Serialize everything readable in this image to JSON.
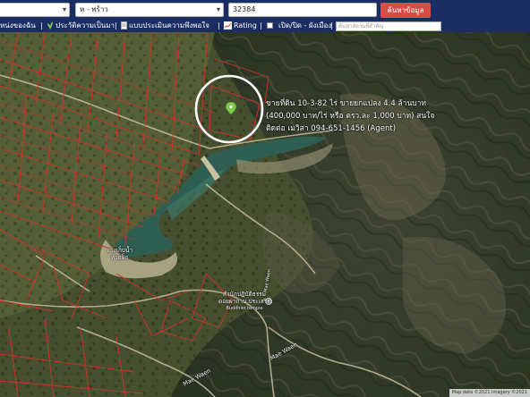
{
  "search": {
    "province_select": "",
    "district_select": "ห - พร้าว",
    "code_value": "32384",
    "submit_label": "ค้นหาข้อมูล"
  },
  "toolbar": {
    "item0": "หน่งของฉัน",
    "item1": "ประวัติความเป็นมา",
    "item2": "แบบประเมินความพึงพอใจ",
    "item3": "Rating",
    "item4": "เปิด/ปิด - ผังเมือง",
    "place_placeholder": "ค้นหาสถานที่สำคัญ"
  },
  "listing": {
    "line1": "ขายที่ดิน 10-3-82 ไร่ ขายยกแปลง 4.4 ล้านบาท",
    "line2": "(400,000 บาท/ไร่ หรือ ตรว.ละ 1,000 บาท) สนใจ",
    "line3": "ติดต่อ เมวิสา 094-651-1456 (Agent)"
  },
  "map_labels": {
    "reservoir_1": "อ่างเก็บน้ำ",
    "reservoir_2": "ห้วยผ็ก",
    "temple_1": "สำนักปฏิบัติธรรม",
    "temple_2": "ดอยผาถ่าน ประเสริฐ",
    "temple_3": "Buddhist temple",
    "road_1": "Mae Waen",
    "road_2": "Mae Waen",
    "road_3": "Mae Waen"
  },
  "attribution": "Map data ©2021 Imagery ©2021",
  "colors": {
    "header": "#1a2e63",
    "button": "#d94b45",
    "parcel_lines": "#d9302a",
    "marker": "#7ec850",
    "highlight_circle": "#ffffff"
  },
  "icons": [
    "chevron-down-icon",
    "history-icon",
    "document-icon",
    "chart-icon",
    "checkbox-icon",
    "location-pin-icon"
  ]
}
